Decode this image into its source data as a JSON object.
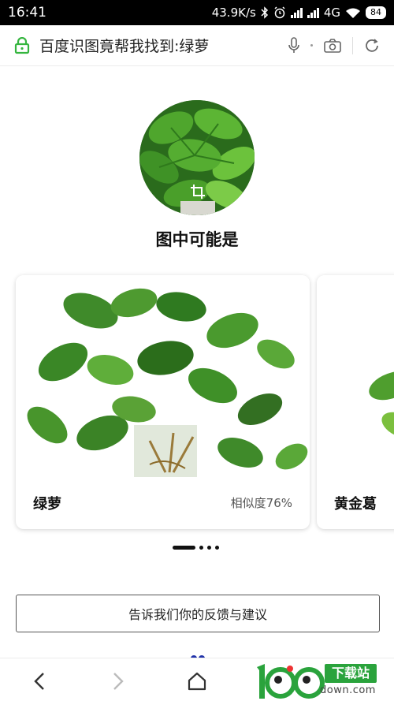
{
  "status_bar": {
    "time": "16:41",
    "network_speed": "43.9K/s",
    "network_type": "4G",
    "battery": "84"
  },
  "address_bar": {
    "title": "百度识图竟帮我找到:绿萝"
  },
  "main": {
    "heading": "图中可能是",
    "cards": [
      {
        "name": "绿萝",
        "similarity": "相似度76%"
      },
      {
        "name": "黄金葛"
      }
    ],
    "pager": {
      "total": 4,
      "active": 1
    },
    "feedback_label": "告诉我们你的反馈与建议"
  },
  "watermark": {
    "brand_text": "下载站",
    "domain_text": "down.com",
    "number_text": "100"
  },
  "colors": {
    "lock_green": "#35b53f",
    "watermark_green": "#2aa33c"
  }
}
